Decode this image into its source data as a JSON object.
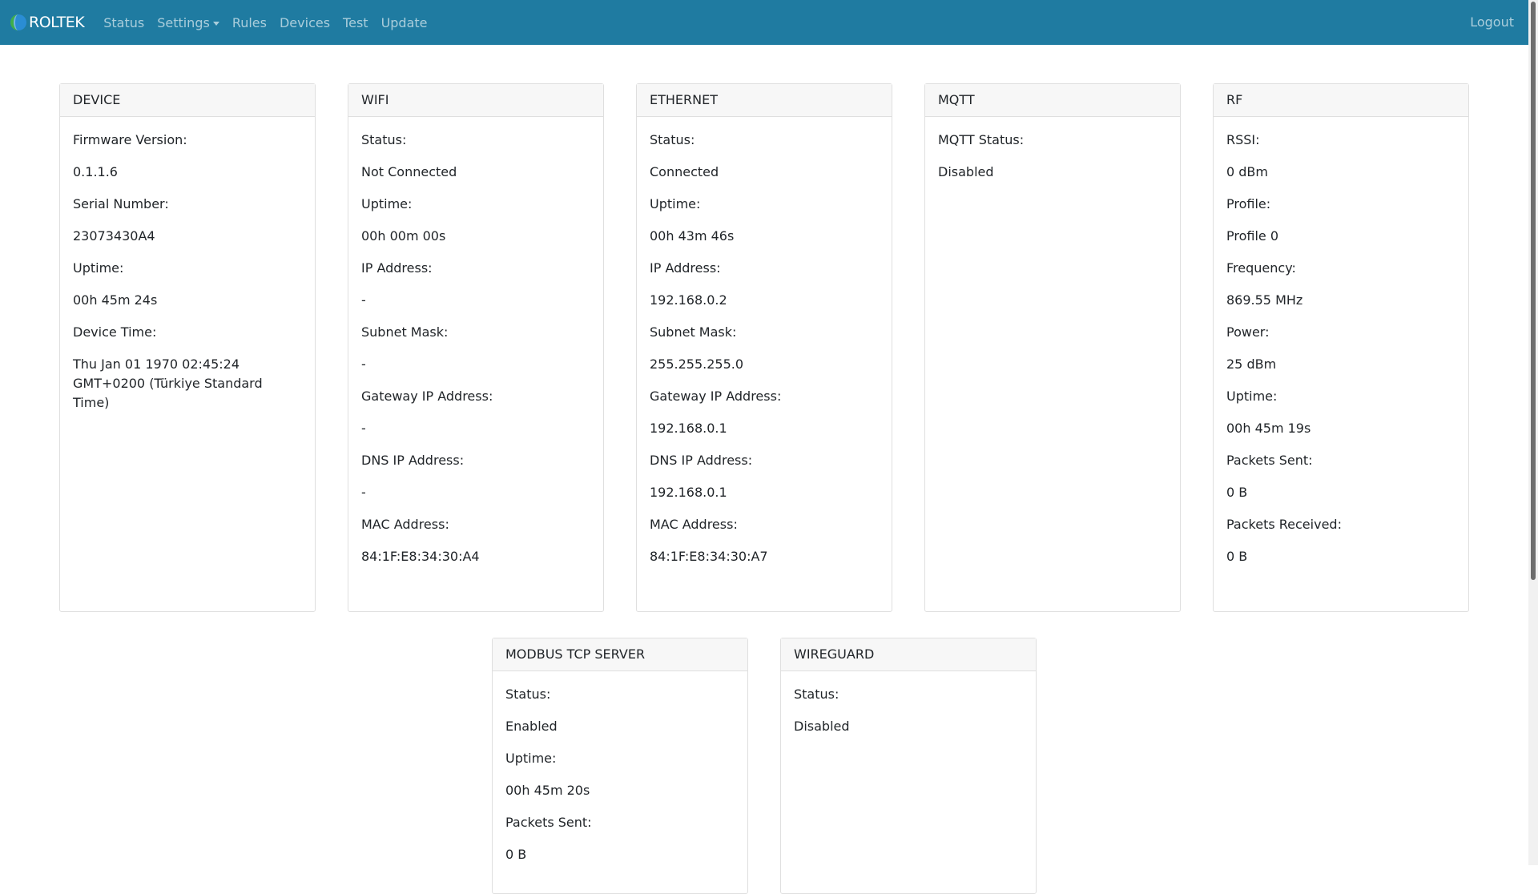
{
  "nav": {
    "brand": "ROLTEK",
    "items": [
      "Status",
      "Settings",
      "Rules",
      "Devices",
      "Test",
      "Update"
    ],
    "logout": "Logout"
  },
  "colors": {
    "navbar": "#1f7ba1",
    "logo_green": "#3fae49",
    "logo_blue": "#2a8dd4"
  },
  "cards": {
    "device": {
      "title": "DEVICE",
      "rows": [
        "Firmware Version:",
        "0.1.1.6",
        "Serial Number:",
        "23073430A4",
        "Uptime:",
        "00h 45m 24s",
        "Device Time:",
        "Thu Jan 01 1970 02:45:24 GMT+0200 (Türkiye Standard Time)"
      ]
    },
    "wifi": {
      "title": "WIFI",
      "rows": [
        "Status:",
        "Not Connected",
        "Uptime:",
        "00h 00m 00s",
        "IP Address:",
        "-",
        "Subnet Mask:",
        "-",
        "Gateway IP Address:",
        "-",
        "DNS IP Address:",
        "-",
        "MAC Address:",
        "84:1F:E8:34:30:A4"
      ]
    },
    "ethernet": {
      "title": "ETHERNET",
      "rows": [
        "Status:",
        "Connected",
        "Uptime:",
        "00h 43m 46s",
        "IP Address:",
        "192.168.0.2",
        "Subnet Mask:",
        "255.255.255.0",
        "Gateway IP Address:",
        "192.168.0.1",
        "DNS IP Address:",
        "192.168.0.1",
        "MAC Address:",
        "84:1F:E8:34:30:A7"
      ]
    },
    "mqtt": {
      "title": "MQTT",
      "rows": [
        "MQTT Status:",
        "Disabled"
      ]
    },
    "rf": {
      "title": "RF",
      "rows": [
        "RSSI:",
        "0 dBm",
        "Profile:",
        "Profile 0",
        "Frequency:",
        "869.55 MHz",
        "Power:",
        "25 dBm",
        "Uptime:",
        "00h 45m 19s",
        "Packets Sent:",
        "0 B",
        "Packets Received:",
        "0 B"
      ]
    },
    "modbus": {
      "title": "MODBUS TCP SERVER",
      "rows": [
        "Status:",
        "Enabled",
        "Uptime:",
        "00h 45m 20s",
        "Packets Sent:",
        "0 B"
      ]
    },
    "wireguard": {
      "title": "WIREGUARD",
      "rows": [
        "Status:",
        "Disabled"
      ]
    }
  }
}
